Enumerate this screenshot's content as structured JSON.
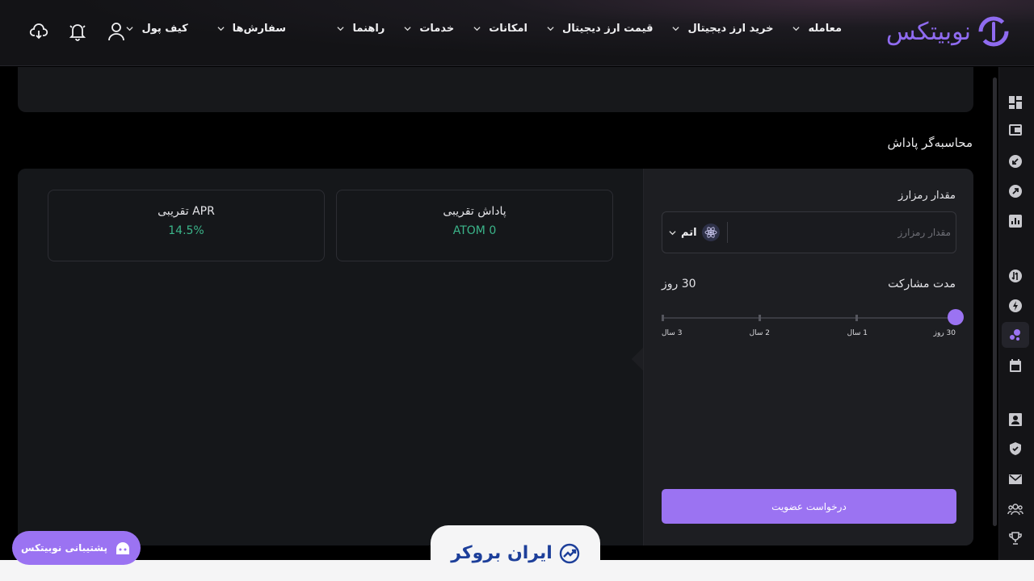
{
  "brand": {
    "name": "نوبیتکس",
    "accent": "#9b73f2"
  },
  "nav": {
    "main": [
      "معامله",
      "خرید ارز دیجیتال",
      "قیمت ارز دیجیتال",
      "امکانات",
      "خدمات",
      "راهنما"
    ],
    "account": [
      "سفارش‌ها",
      "کیف پول"
    ]
  },
  "top_icons": [
    "user-icon",
    "bell-icon",
    "download-icon"
  ],
  "sidebar_icons": [
    "dashboard-icon",
    "wallet-icon",
    "deposit-icon",
    "withdraw-icon",
    "chart-icon",
    "exchange-icon",
    "lightning-icon",
    "staking-icon",
    "calendar-icon",
    "profile-icon",
    "shield-icon",
    "mail-icon",
    "group-icon",
    "trophy-icon"
  ],
  "calculator": {
    "title": "محاسبه‌گر پاداش",
    "amount_label": "مقدار رمزارز",
    "amount_placeholder": "مقدار رمزارز",
    "coin": "اتم",
    "duration_label": "مدت مشارکت",
    "duration_value": "30 روز",
    "duration_options": [
      "30 روز",
      "1 سال",
      "2 سال",
      "3 سال"
    ],
    "selected_index": 0,
    "join_button": "درخواست عضویت"
  },
  "stats": {
    "reward_label": "پاداش تقریبی",
    "reward_value": "ATOM 0",
    "apr_label": "APR تقریبی",
    "apr_value": "14.5%"
  },
  "support": {
    "label": "پشتیبانی نوبیتکس"
  },
  "footer_brand": {
    "label": "ایران بروکر"
  }
}
